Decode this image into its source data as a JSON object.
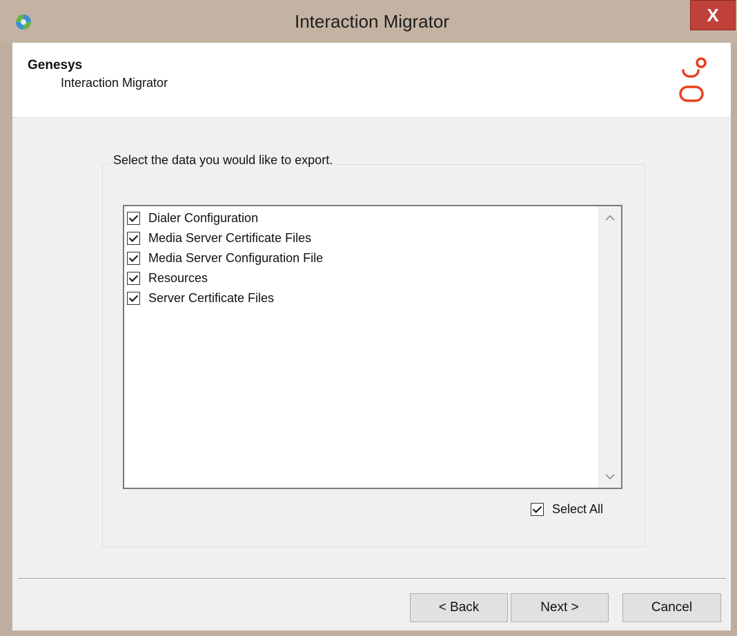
{
  "window": {
    "title": "Interaction Migrator",
    "close_label": "X"
  },
  "header": {
    "brand": "Genesys",
    "subtitle": "Interaction Migrator",
    "logo_icon": "genesys-logo-icon",
    "logo_color": "#e8401c"
  },
  "group": {
    "label": "Select the data you would like to export."
  },
  "items": [
    {
      "label": "Dialer Configuration",
      "checked": true
    },
    {
      "label": "Media Server Certificate Files",
      "checked": true
    },
    {
      "label": "Media Server Configuration File",
      "checked": true
    },
    {
      "label": "Resources",
      "checked": true
    },
    {
      "label": "Server Certificate Files",
      "checked": true
    }
  ],
  "select_all": {
    "label": "Select All",
    "checked": true
  },
  "buttons": {
    "back": "< Back",
    "next": "Next >",
    "cancel": "Cancel"
  }
}
